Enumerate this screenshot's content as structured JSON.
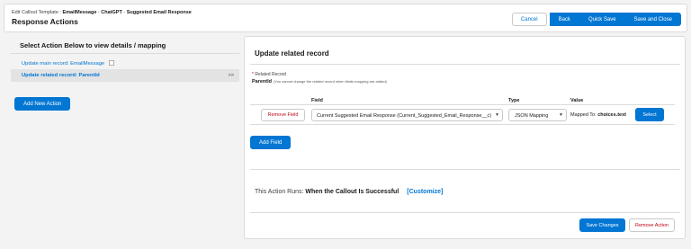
{
  "header": {
    "breadcrumb_prefix": "Edit Callout Template : ",
    "breadcrumb_parts": [
      "EmailMessage",
      "ChatGPT",
      "Suggested Email Response"
    ],
    "breadcrumb_sep": " - ",
    "title": "Response Actions",
    "buttons": {
      "cancel": "Cancel",
      "back": "Back",
      "quick_save": "Quick Save",
      "save_close": "Save and Close"
    }
  },
  "left_panel": {
    "title": "Select Action Below to view details / mapping",
    "actions": [
      {
        "label": "Update main record: EmailMessage",
        "has_checkbox": true
      },
      {
        "label": "Update related record: ParentId",
        "selected": true,
        "arrow": ">>"
      }
    ],
    "add_action": "Add New Action"
  },
  "detail": {
    "title": "Update related record",
    "related_record_label": "Related Record",
    "required_mark": "*",
    "related_record_value": "ParentId",
    "related_record_note": "(You cannot change the related record when fields mapping are added)",
    "columns": {
      "field": "Field",
      "type": "Type",
      "value": "Value"
    },
    "rows": [
      {
        "remove": "Remove Field",
        "field": "Current Suggested Email Response (Current_Suggested_Email_Response__c)",
        "type": "JSON Mapping",
        "mapped_prefix": "Mapped To:",
        "mapped_value": "choices.text",
        "select": "Select"
      }
    ],
    "add_field": "Add Field",
    "runs_prefix": "This Action Runs:",
    "runs_value": "When the Callout Is Successful",
    "customize": "[Customize]",
    "save_changes": "Save Changes",
    "remove_action": "Remove Action"
  },
  "colors": {
    "brand": "#0176d3",
    "destructive": "#ba0517",
    "background": "#f3f3f3"
  }
}
